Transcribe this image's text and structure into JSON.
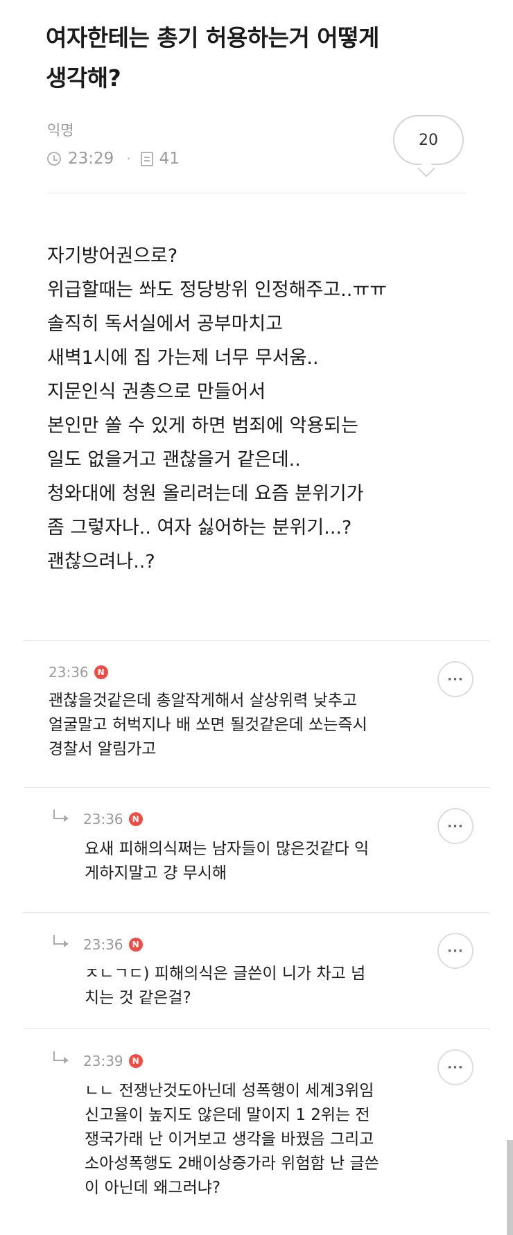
{
  "post": {
    "title_line1": "여자한테는 총기 허용하는거 어떻게",
    "title_line2": "생각해?",
    "author": "익명",
    "time": "23:29",
    "dot": "·",
    "views": "41",
    "comment_count": "20",
    "body": [
      "자기방어권으로?",
      "위급할때는 쏴도 정당방위 인정해주고..ㅠㅠ",
      "솔직히 독서실에서 공부마치고",
      "새벽1시에 집 가는제 너무 무서움..",
      "지문인식 권총으로 만들어서",
      "본인만 쏠 수 있게 하면 범죄에 악용되는",
      "일도 없을거고 괜찮을거 같은데..",
      "청와대에 청원 올리려는데 요즘 분위기가",
      "좀 그렇자나.. 여자 싫어하는 분위기...?",
      "괜찮으려나..?"
    ]
  },
  "badge_label": "N",
  "more_label": "···",
  "comments": [
    {
      "time": "23:36",
      "lines": [
        "괜찮을것같은데 총알작게해서 살상위력 낮추고",
        "얼굴말고 허벅지나 배 쏘면 될것같은데 쏘는즉시",
        "경찰서 알림가고"
      ]
    },
    {
      "time": "23:36",
      "lines": [
        "요새 피해의식쩌는 남자들이 많은것같다 익",
        "게하지말고 걍 무시해"
      ]
    },
    {
      "time": "23:36",
      "lines": [
        "ㅈㄴㄱㄷ) 피해의식은 글쓴이 니가 차고 넘",
        "치는 것 같은걸?"
      ]
    },
    {
      "time": "23:39",
      "lines": [
        "ㄴㄴ 전쟁난것도아닌데 성폭행이 세계3위임",
        "신고율이 높지도 않은데 말이지 1 2위는 전",
        "쟁국가래 난 이거보고 생각을 바꿨음 그리고",
        "소아성폭행도 2배이상증가라 위험함 난 글쓴",
        "이 아닌데 왜그러냐?"
      ]
    }
  ]
}
